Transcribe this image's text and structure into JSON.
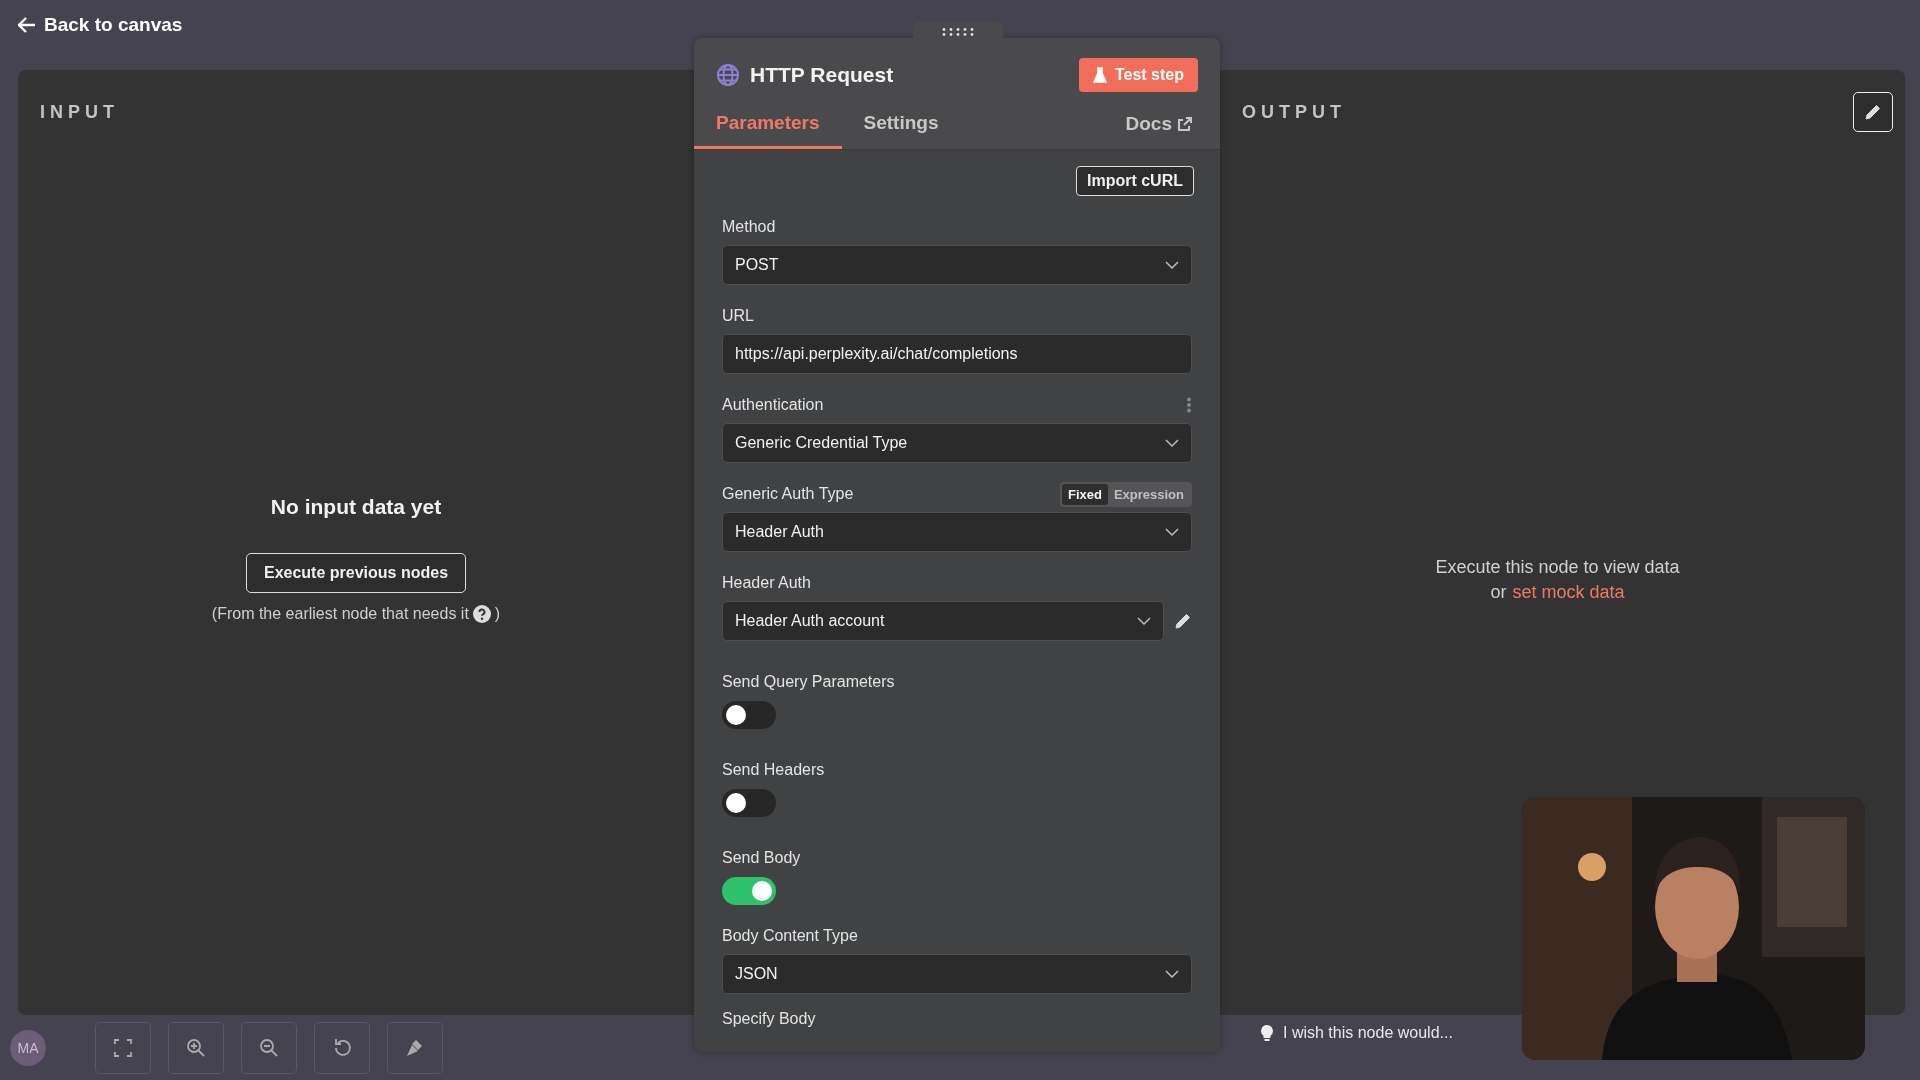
{
  "top_bar": {
    "back_label": "Back to canvas"
  },
  "input_panel": {
    "title": "INPUT",
    "empty_title": "No input data yet",
    "button": "Execute previous nodes",
    "hint": "(From the earliest node that needs it",
    "hint_end": ")"
  },
  "node": {
    "title": "HTTP Request",
    "test_button": "Test step",
    "docs": "Docs",
    "import_button": "Import cURL",
    "tabs": [
      {
        "label": "Parameters",
        "selected": true
      },
      {
        "label": "Settings",
        "selected": false
      }
    ],
    "fields": [
      {
        "kind": "select",
        "label": "Method",
        "value": "POST"
      },
      {
        "kind": "text",
        "label": "URL",
        "value": "https://api.perplexity.ai/chat/completions"
      },
      {
        "kind": "select",
        "label": "Authentication",
        "value": "Generic Credential Type",
        "has_options": true
      },
      {
        "kind": "select",
        "label": "Generic Auth Type",
        "value": "Header Auth",
        "modes": [
          {
            "label": "Fixed",
            "selected": true
          },
          {
            "label": "Expression",
            "selected": false
          }
        ]
      },
      {
        "kind": "credential",
        "label": "Header Auth",
        "value": "Header Auth account"
      },
      {
        "kind": "toggle",
        "label": "Send Query Parameters",
        "on": false
      },
      {
        "kind": "toggle",
        "label": "Send Headers",
        "on": false
      },
      {
        "kind": "toggle",
        "label": "Send Body",
        "on": true
      },
      {
        "kind": "select",
        "label": "Body Content Type",
        "value": "JSON"
      },
      {
        "kind": "heading",
        "label": "Specify Body"
      }
    ]
  },
  "output_panel": {
    "title": "OUTPUT",
    "message": "Execute this node to view data",
    "link_prefix": "or",
    "link": "set mock data"
  },
  "toolbar": {
    "user_initials": "MA",
    "feedback": "I wish this node would..."
  }
}
